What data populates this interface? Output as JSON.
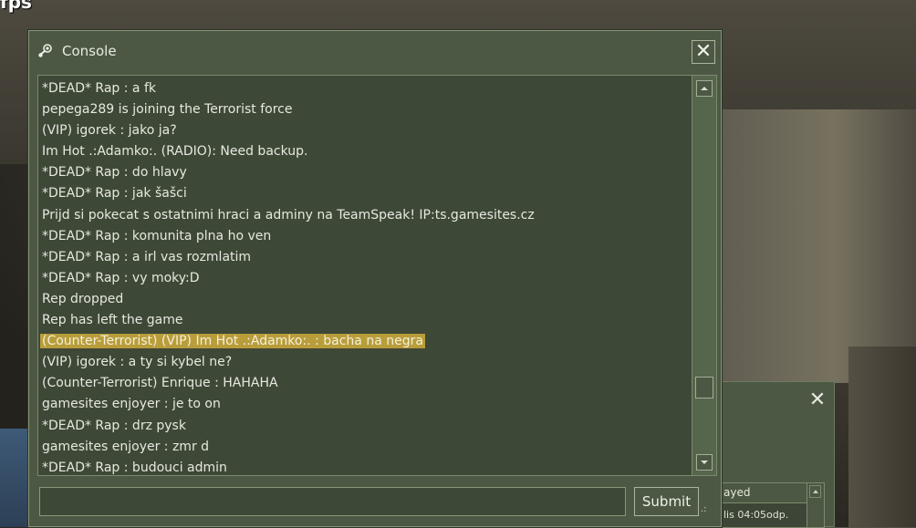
{
  "hud": {
    "fps_label": "fps"
  },
  "console": {
    "title": "Console",
    "title_icon": "steam-icon",
    "close_label": "✕",
    "log_lines": [
      "*DEAD* Rap : a fk",
      "pepega289 is joining the Terrorist force",
      "(VIP) igorek : jako ja?",
      "Im Hot .:Adamko:. (RADIO): Need backup.",
      "*DEAD* Rap : do hlavy",
      "*DEAD* Rap : jak šašci",
      "Prijd si pokecat s ostatnimi hraci a adminy na TeamSpeak! IP:ts.gamesites.cz",
      "*DEAD* Rap : komunita plna ho ven",
      "*DEAD* Rap : a irl vas rozmlatim",
      "*DEAD* Rap : vy moky:D",
      "Rep dropped",
      "Rep has left the game",
      "(Counter-Terrorist) (VIP) Im Hot .:Adamko:. : bacha na negra",
      "(VIP) igorek : a ty si kybel ne?",
      "(Counter-Terrorist) Enrique : HAHAHA",
      "gamesites enjoyer : je to on",
      "*DEAD* Rap : drz pysk",
      "gamesites enjoyer : zmr  d",
      "*DEAD* Rap : budouci admin"
    ],
    "highlighted_line_index": 12,
    "input_value": "",
    "submit_label": "Submit"
  },
  "back_panel": {
    "close_label": "✕",
    "list_header": "ayed",
    "list_cell": "lis 04:05odp."
  },
  "colors": {
    "panel": "#4c5844",
    "log_bg": "#3e4837",
    "highlight": "#b89d3a",
    "text": "#e6e9e0"
  }
}
